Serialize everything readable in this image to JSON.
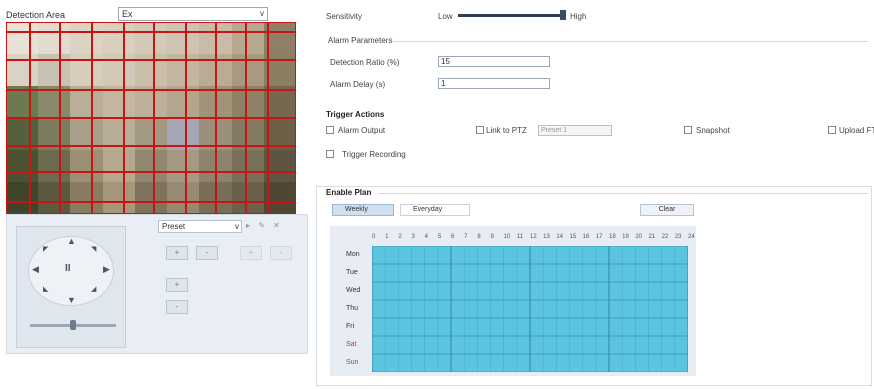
{
  "detection": {
    "label": "Detection Area",
    "select_value": "Ex",
    "caret": "v"
  },
  "ptz": {
    "preset_value": "Preset",
    "preset_caret": "v",
    "preset_icons": "▸ ✎ ✕",
    "buttons": [
      "+",
      "-",
      "+",
      "-"
    ],
    "button_focus": "+",
    "button_iris": "-",
    "dpad_center": "II"
  },
  "right": {
    "sensitivity_label": "Sensitivity",
    "sensitivity_low": "Low",
    "sensitivity_high": "High",
    "alarm_section": "Alarm Parameters",
    "ratio_label": "Detection Ratio (%)",
    "ratio_value": "15",
    "delay_label": "Alarm Delay (s)",
    "delay_value": "1",
    "trigger_title": "Trigger Actions",
    "trigger_alarm_output": "Alarm Output",
    "trigger_ptz": "Link to PTZ",
    "trigger_ptz_select": "Preset 1",
    "trigger_snapshot": "Snapshot",
    "trigger_upload": "Upload FTP",
    "trigger_record": "Trigger Recording",
    "schedule_title": "Enable Plan",
    "tab_weekly": "Weekly",
    "tab_everyday": "Everyday",
    "clear_label": "Clear",
    "hours": [
      "0",
      "1",
      "2",
      "3",
      "4",
      "5",
      "6",
      "7",
      "8",
      "9",
      "10",
      "11",
      "12",
      "13",
      "14",
      "15",
      "16",
      "17",
      "18",
      "19",
      "20",
      "21",
      "22",
      "23",
      "24"
    ],
    "days": [
      "Mon",
      "Tue",
      "Wed",
      "Thu",
      "Fri",
      "Sat",
      "Sun"
    ],
    "weekday_color": "#333333",
    "weekend_color": "#c0392b",
    "schedule_color": "#5bc5df"
  }
}
